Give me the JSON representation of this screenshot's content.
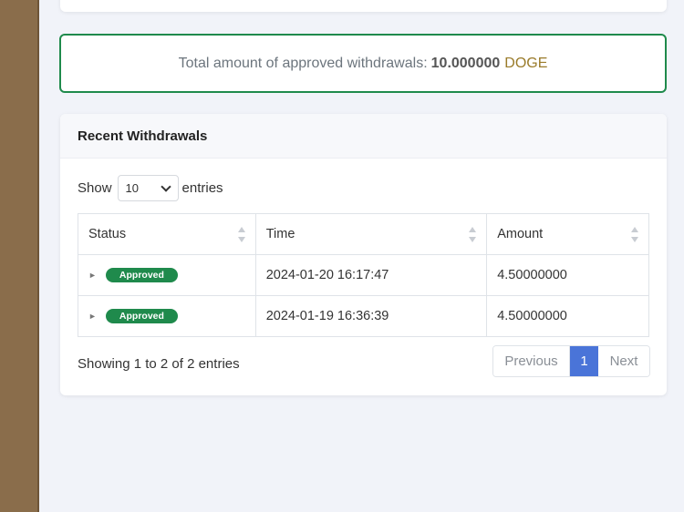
{
  "summary": {
    "label": "Total amount of approved withdrawals:",
    "amount": "10.000000",
    "currency": "DOGE"
  },
  "recent": {
    "title": "Recent Withdrawals",
    "show_label": "Show",
    "entries_label": "entries",
    "page_length": "10",
    "columns": [
      "Status",
      "Time",
      "Amount"
    ],
    "rows": [
      {
        "status": "Approved",
        "time": "2024-01-20 16:17:47",
        "amount": "4.50000000"
      },
      {
        "status": "Approved",
        "time": "2024-01-19 16:36:39",
        "amount": "4.50000000"
      }
    ],
    "info": "Showing 1 to 2 of 2 entries",
    "pagination": {
      "previous": "Previous",
      "current": "1",
      "next": "Next"
    }
  },
  "icons": {
    "row_expand": "►"
  },
  "colors": {
    "accent_green": "#1f8a4c",
    "pagination_active": "#4a74d8",
    "currency": "#9a7b2a"
  }
}
